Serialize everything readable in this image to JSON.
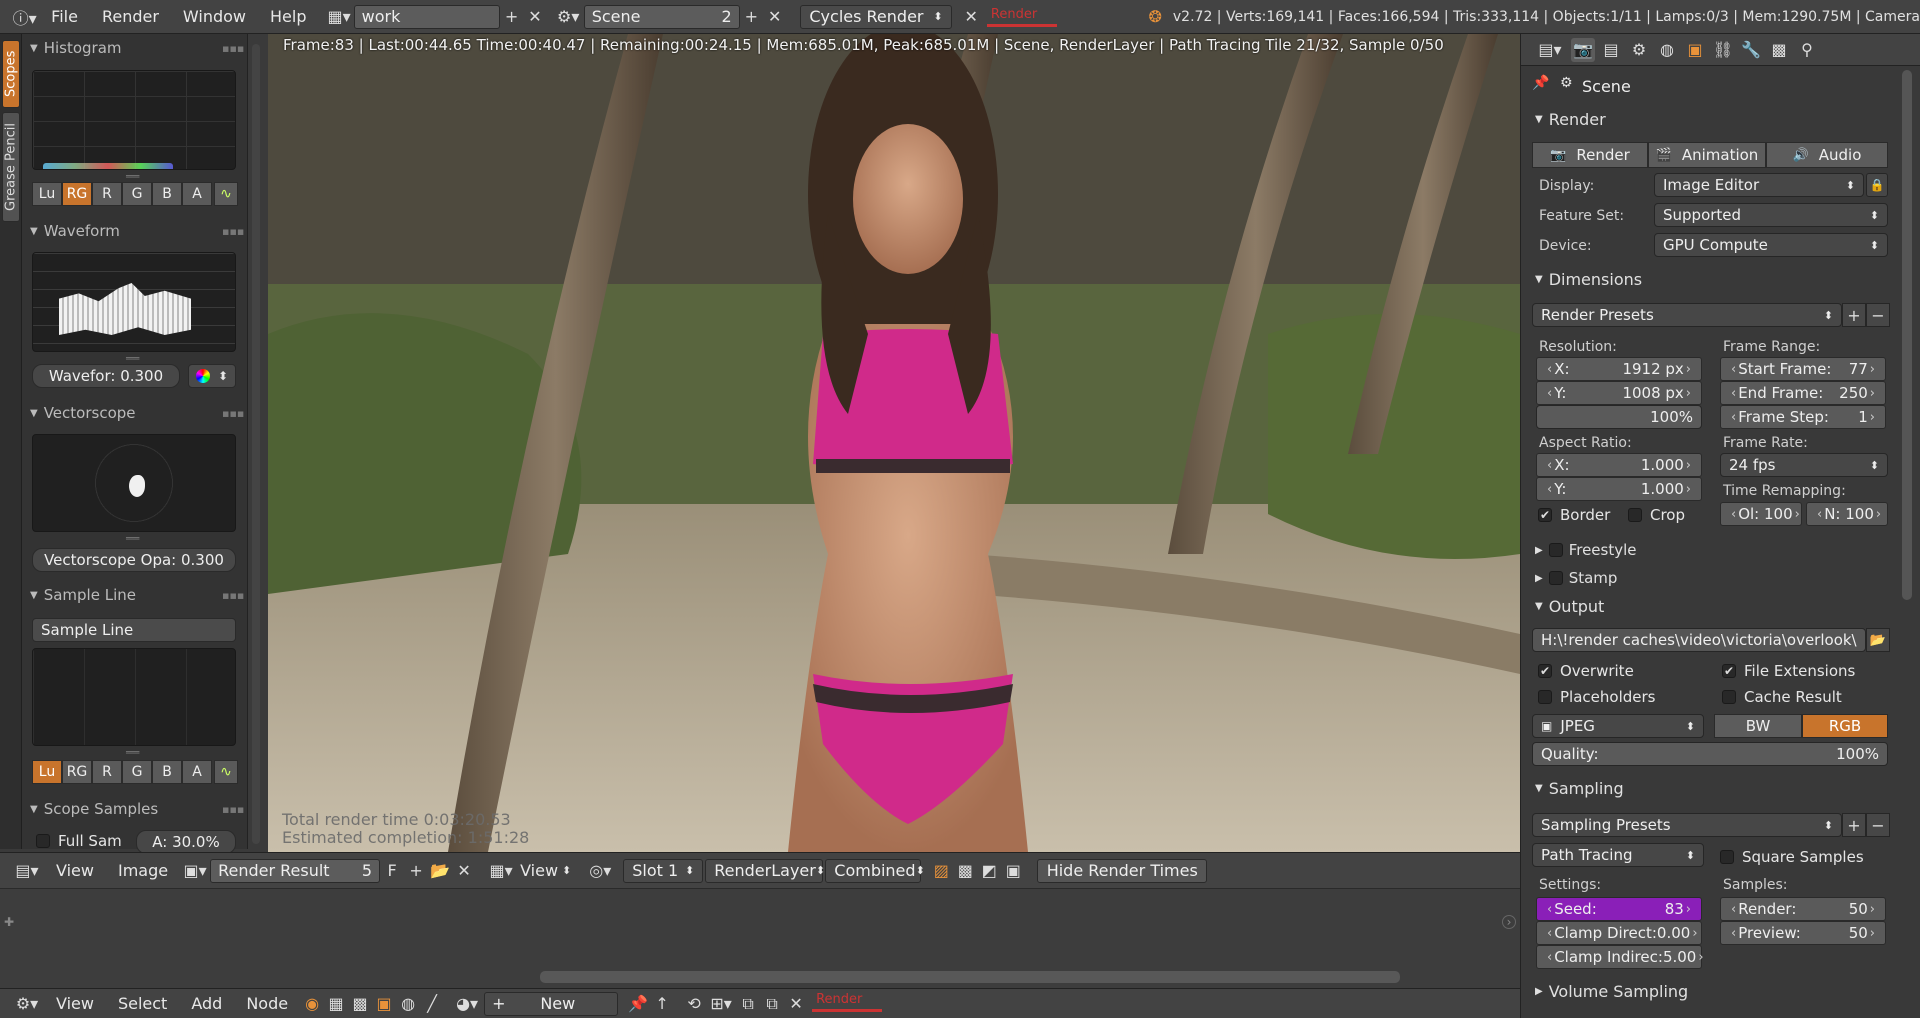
{
  "top": {
    "menus": [
      "File",
      "Render",
      "Window",
      "Help"
    ],
    "screen_layout": "work",
    "scene": "Scene",
    "scene_count": "2",
    "engine": "Cycles Render",
    "progress_label": "Render",
    "stats": "v2.72 | Verts:169,141 | Faces:166,594 | Tris:333,114 | Objects:1/11 | Lamps:0/3 | Mem:1290.75M | Camera"
  },
  "left": {
    "tabs": [
      "Scopes",
      "Grease Pencil"
    ],
    "histogram_title": "Histogram",
    "histogram_buttons": [
      "Lu",
      "RG",
      "R",
      "G",
      "B",
      "A"
    ],
    "waveform_title": "Waveform",
    "waveform_opacity": "Wavefor:  0.300",
    "vectorscope_title": "Vectorscope",
    "vectorscope_opacity": "Vectorscope Opa: 0.300",
    "sampleline_title": "Sample Line",
    "sampleline_button": "Sample Line",
    "sample_buttons": [
      "Lu",
      "RG",
      "R",
      "G",
      "B",
      "A"
    ],
    "scopesamples_title": "Scope Samples",
    "fullsam": "Full Sam",
    "accuracy": "A: 30.0%"
  },
  "viewport": {
    "render_info": "Frame:83 | Last:00:44.65 Time:00:40.47 | Remaining:00:24.15 | Mem:685.01M, Peak:685.01M | Scene, RenderLayer | Path Tracing Tile 21/32, Sample 0/50",
    "total_time": "Total render time 0:03:20.53",
    "estimated": "Estimated completion: 1:51:28"
  },
  "image_header": {
    "view": "View",
    "image": "Image",
    "image_name": "Render Result",
    "users": "5",
    "fake": "F",
    "view2": "View",
    "slot": "Slot 1",
    "layer": "RenderLayer",
    "pass": "Combined",
    "hide_times": "Hide Render Times"
  },
  "node_header": {
    "menus": [
      "View",
      "Select",
      "Add",
      "Node"
    ],
    "new": "New",
    "progress_label": "Render"
  },
  "props": {
    "scene": "Scene",
    "render_section": "Render",
    "render_tabs": [
      "Render",
      "Animation",
      "Audio"
    ],
    "display_label": "Display:",
    "display_value": "Image Editor",
    "featureset_label": "Feature Set:",
    "featureset_value": "Supported",
    "device_label": "Device:",
    "device_value": "GPU Compute",
    "dimensions_section": "Dimensions",
    "render_presets": "Render Presets",
    "resolution_label": "Resolution:",
    "res_x": "1912 px",
    "res_y": "1008 px",
    "res_pct": "100%",
    "framerange_label": "Frame Range:",
    "start_frame": "77",
    "end_frame": "250",
    "frame_step": "1",
    "start_label": "Start Frame:",
    "end_label": "End Frame:",
    "step_label": "Frame Step:",
    "aspect_label": "Aspect Ratio:",
    "aspect_x": "1.000",
    "aspect_y": "1.000",
    "framerate_label": "Frame Rate:",
    "framerate": "24 fps",
    "timeremap_label": "Time Remapping:",
    "ol": "Ol: 100",
    "n": "N: 100",
    "x_label": "X:",
    "y_label": "Y:",
    "border": "Border",
    "crop": "Crop",
    "freestyle": "Freestyle",
    "stamp": "Stamp",
    "output_section": "Output",
    "output_path": "H:\\!render caches\\video\\victoria\\overlook\\",
    "overwrite": "Overwrite",
    "file_extensions": "File Extensions",
    "placeholders": "Placeholders",
    "cache_result": "Cache Result",
    "format": "JPEG",
    "bw": "BW",
    "rgb": "RGB",
    "quality_label": "Quality:",
    "quality": "100%",
    "sampling_section": "Sampling",
    "sampling_presets": "Sampling Presets",
    "integrator": "Path Tracing",
    "square_samples": "Square Samples",
    "settings_label": "Settings:",
    "samples_label": "Samples:",
    "seed_label": "Seed:",
    "seed": "83",
    "clamp_direct_label": "Clamp Direct:",
    "clamp_direct": "0.00",
    "clamp_indirect_label": "Clamp Indirec:",
    "clamp_indirect": "5.00",
    "render_samples_label": "Render:",
    "render_samples": "50",
    "preview_samples_label": "Preview:",
    "preview_samples": "50",
    "volume_section": "Volume Sampling"
  },
  "colors": {
    "accent": "#c8742c",
    "seed_highlight": "#8a1fb8"
  }
}
